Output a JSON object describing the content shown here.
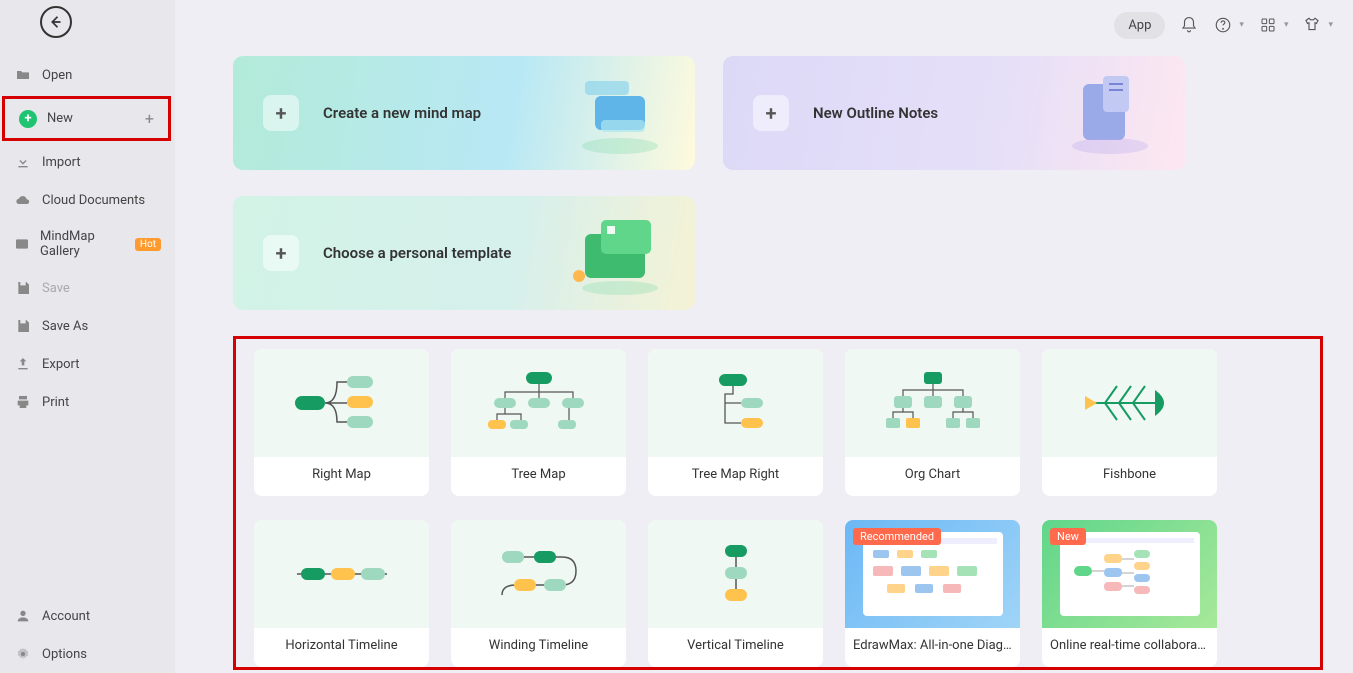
{
  "topbar": {
    "app": "App"
  },
  "sidebar": {
    "open": "Open",
    "new": "New",
    "import": "Import",
    "cloud": "Cloud Documents",
    "gallery": "MindMap Gallery",
    "hot": "Hot",
    "save": "Save",
    "saveas": "Save As",
    "export": "Export",
    "print": "Print",
    "account": "Account",
    "options": "Options"
  },
  "cards": {
    "newmind": "Create a new mind map",
    "outline": "New Outline Notes",
    "personal": "Choose a personal template"
  },
  "templates": [
    {
      "label": "Right Map"
    },
    {
      "label": "Tree Map"
    },
    {
      "label": "Tree Map Right"
    },
    {
      "label": "Org Chart"
    },
    {
      "label": "Fishbone"
    },
    {
      "label": "Horizontal Timeline"
    },
    {
      "label": "Winding Timeline"
    },
    {
      "label": "Vertical Timeline"
    },
    {
      "label": "EdrawMax: All-in-one Diag...",
      "badge": "Recommended"
    },
    {
      "label": "Online real-time collaborat...",
      "badge": "New"
    }
  ]
}
